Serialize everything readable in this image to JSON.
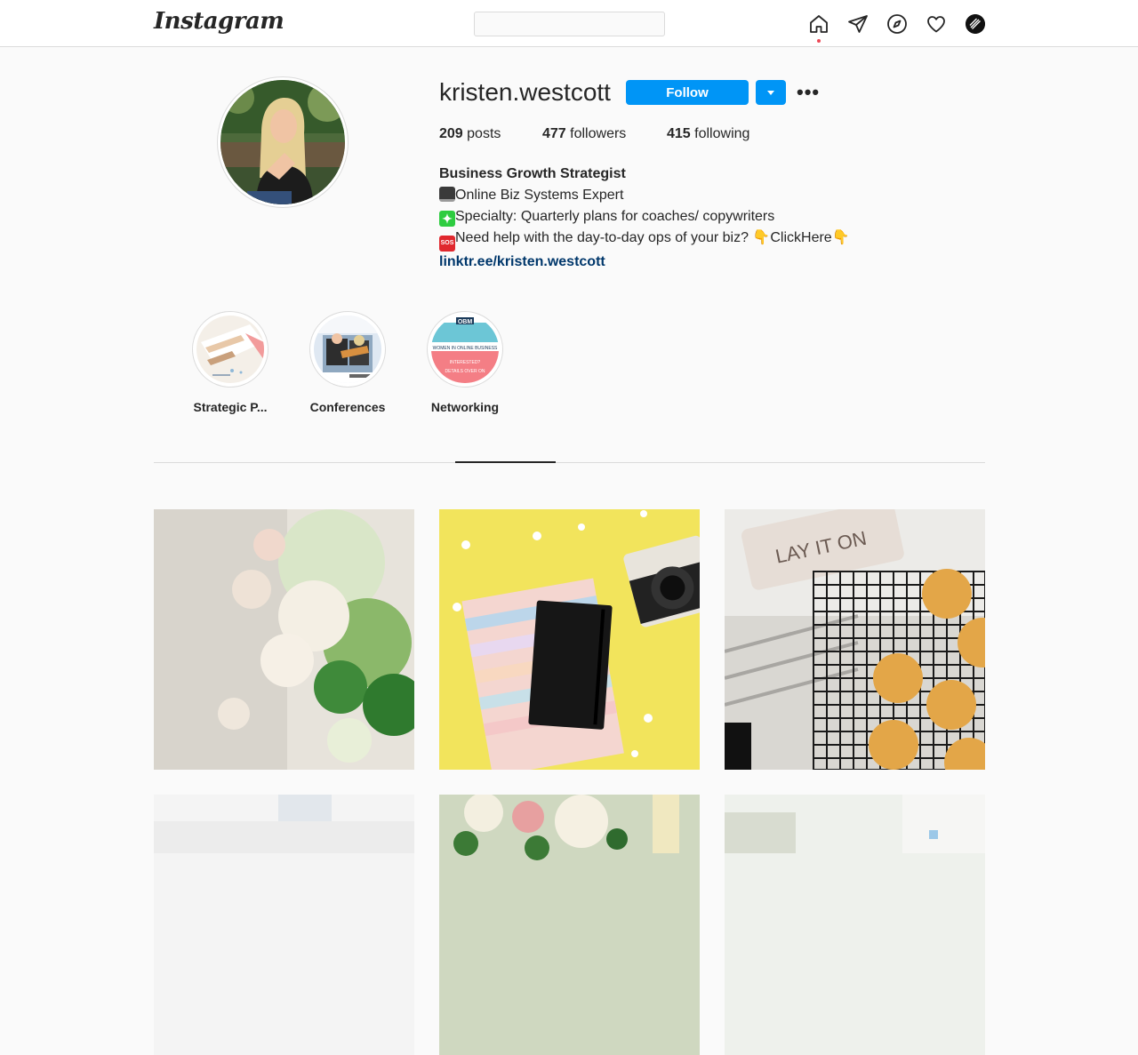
{
  "nav": {
    "logo": "Instagram",
    "search_placeholder": "",
    "icons": [
      "home-icon",
      "direct-icon",
      "explore-icon",
      "activity-icon",
      "profile-avatar"
    ]
  },
  "profile": {
    "username": "kristen.westcott",
    "follow_label": "Follow",
    "more_label": "•••",
    "stats": {
      "posts_count": "209",
      "posts_label": "posts",
      "followers_count": "477",
      "followers_label": "followers",
      "following_count": "415",
      "following_label": "following"
    },
    "bio": {
      "name": "Business Growth Strategist",
      "line1": "Online Biz Systems Expert",
      "line2": "Specialty: Quarterly plans for coaches/ copywriters",
      "line3_a": "Need help with the day-to-day ops of your biz? ",
      "line3_b": "ClickHere",
      "sos_badge": "SOS",
      "link": "linktr.ee/kristen.westcott"
    }
  },
  "highlights": [
    {
      "label": "Strategic P..."
    },
    {
      "label": "Conferences"
    },
    {
      "label": "Networking"
    }
  ],
  "highlight_texts": {
    "networking_top": "OBM",
    "networking_mid": "WOMEN IN ONLINE BUSINESS",
    "networking_bottom_1": "INTERESTED?",
    "networking_bottom_2": "DETAILS OVER ON"
  },
  "posts": [
    {
      "alt": "white flowers and greenery"
    },
    {
      "alt": "black notebook on pastel planner with camera and daisies"
    },
    {
      "alt": "biscuits on cooling rack",
      "caption_text": "LAY IT ON"
    },
    {
      "alt": "white blurred interior"
    },
    {
      "alt": "flowers and champagne glass"
    },
    {
      "alt": "light blurred scene"
    }
  ],
  "colors": {
    "accent": "#0095f6",
    "link": "#00376b",
    "notification_dot": "#ed4956",
    "border": "#dbdbdb",
    "background": "#fafafa"
  }
}
